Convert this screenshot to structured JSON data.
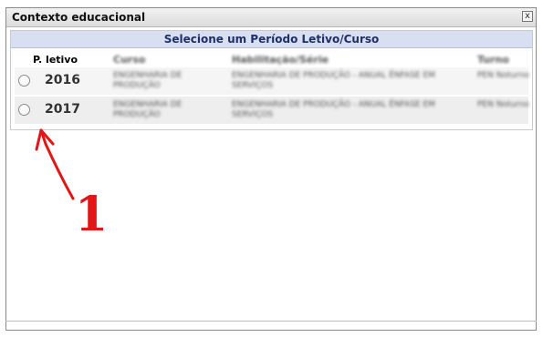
{
  "dialog": {
    "title": "Contexto educacional",
    "close_label": "x"
  },
  "panel": {
    "caption": "Selecione um Período Letivo/Curso",
    "columns": {
      "periodo": "P. letivo",
      "curso": "Curso",
      "habilitacao": "Habilitação/Série",
      "turno": "Turno"
    },
    "rows": [
      {
        "year": "2016",
        "curso": "ENGENHARIA DE PRODUÇÃO",
        "habilitacao": "ENGENHARIA DE PRODUÇÃO - ANUAL ÊNFASE EM SERVIÇOS",
        "turno": "PEN Noturno"
      },
      {
        "year": "2017",
        "curso": "ENGENHARIA DE PRODUÇÃO",
        "habilitacao": "ENGENHARIA DE PRODUÇÃO - ANUAL ÊNFASE EM SERVIÇOS",
        "turno": "PEN Noturno"
      }
    ]
  },
  "annotation": {
    "marker": "1",
    "color": "#e21616"
  }
}
